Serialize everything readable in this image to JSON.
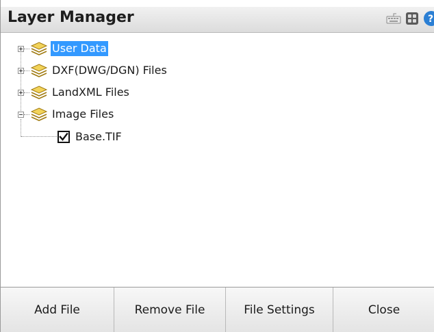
{
  "window": {
    "title": "Layer Manager",
    "title_icons": [
      "keyboard-icon",
      "settings-icon",
      "help-icon"
    ]
  },
  "tree": {
    "nodes": [
      {
        "label": "User Data",
        "expander": "plus",
        "icon": "layers-icon",
        "selected": true
      },
      {
        "label": "DXF(DWG/DGN) Files",
        "expander": "plus",
        "icon": "layers-icon",
        "selected": false
      },
      {
        "label": "LandXML Files",
        "expander": "plus",
        "icon": "layers-icon",
        "selected": false
      },
      {
        "label": "Image Files",
        "expander": "minus",
        "icon": "layers-icon",
        "selected": false,
        "children": [
          {
            "label": "Base.TIF",
            "checked": true
          }
        ]
      }
    ]
  },
  "buttons": {
    "add_file": "Add File",
    "remove_file": "Remove File",
    "file_settings": "File Settings",
    "close": "Close"
  },
  "colors": {
    "selection": "#3399ff",
    "help_icon": "#2b7fd4",
    "layers_icon": "#e8c44a"
  }
}
